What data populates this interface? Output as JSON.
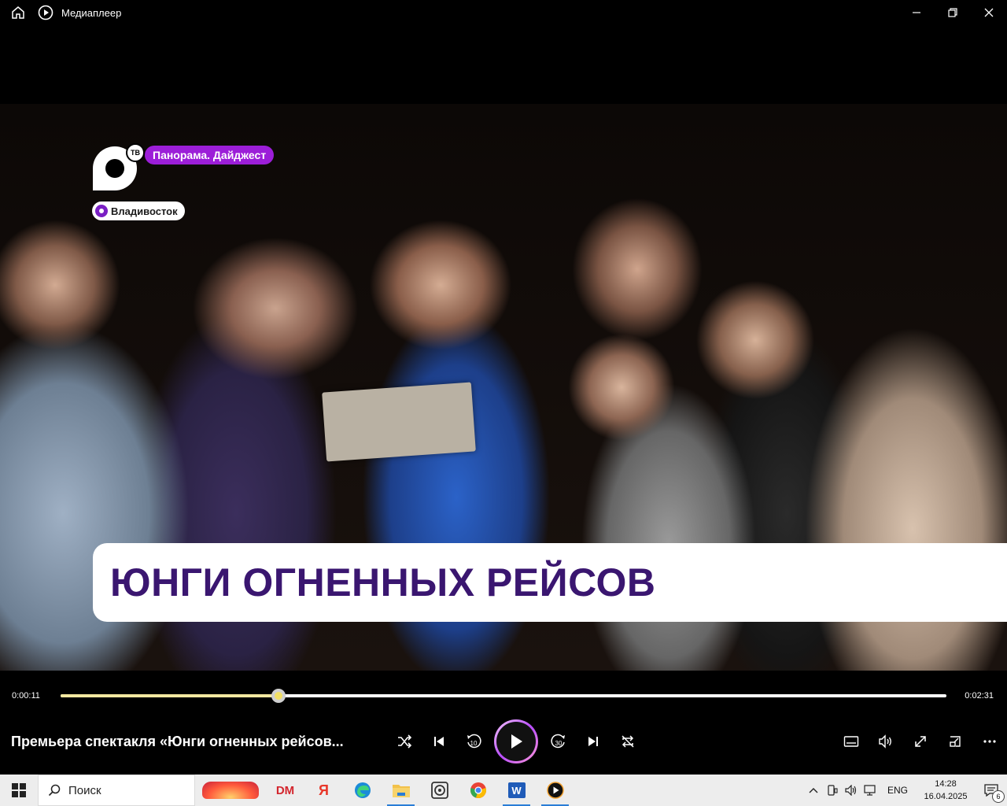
{
  "titlebar": {
    "app_title": "Медиаплеер"
  },
  "video": {
    "program_tag": "Панорама. Дайджест",
    "channel_logo_text": "ТВ",
    "location": "Владивосток",
    "headline": "ЮНГИ ОГНЕННЫХ РЕЙСОВ"
  },
  "seek": {
    "elapsed": "0:00:11",
    "total": "0:02:31",
    "progress_percent": 24.6
  },
  "controls": {
    "now_playing": "Премьера спектакля «Юнги огненных рейсов...",
    "skip_back_seconds": "10",
    "skip_forward_seconds": "30"
  },
  "taskbar": {
    "search_placeholder": "Поиск",
    "apps": [
      "DM",
      "Я",
      "edge",
      "explorer",
      "media-viewer",
      "chrome",
      "W",
      "media-player"
    ],
    "dm_label": "DM",
    "yandex_label": "Я",
    "word_label": "W",
    "language": "ENG",
    "time": "14:28",
    "date": "16.04.2025",
    "notification_count": "6"
  },
  "colors": {
    "accent_purple": "#9c1ed8",
    "headline_text": "#3a1670",
    "progress_fill": "#f4e8a0",
    "taskbar_bg": "#ededed"
  }
}
